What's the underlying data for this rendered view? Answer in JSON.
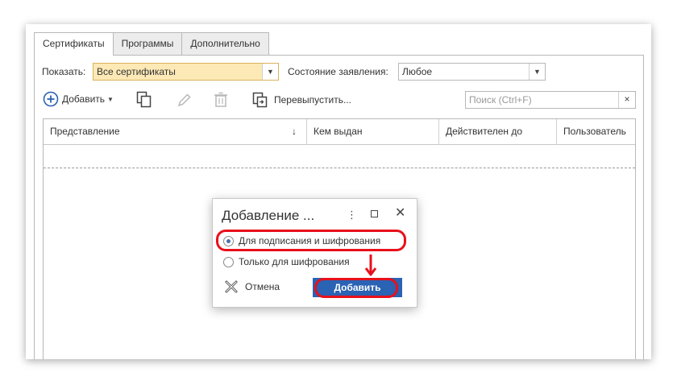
{
  "tabs": [
    {
      "label": "Сертификаты",
      "active": true
    },
    {
      "label": "Программы",
      "active": false
    },
    {
      "label": "Дополнительно",
      "active": false
    }
  ],
  "filters": {
    "show_label": "Показать:",
    "show_value": "Все сертификаты",
    "state_label": "Состояние заявления:",
    "state_value": "Любое"
  },
  "toolbar": {
    "add_label": "Добавить",
    "reissue_label": "Перевыпустить...",
    "search_placeholder": "Поиск (Ctrl+F)",
    "search_clear": "×"
  },
  "table": {
    "columns": [
      "Представление",
      "Кем выдан",
      "Действителен до",
      "Пользователь"
    ],
    "sort_indicator": "↓"
  },
  "dialog": {
    "title": "Добавление ...",
    "option_sign_encrypt": "Для подписания и шифрования",
    "option_encrypt_only": "Только для шифрования",
    "selected_option": "option_sign_encrypt",
    "cancel_label": "Отмена",
    "add_label": "Добавить"
  },
  "colors": {
    "accent_blue": "#2a62b4",
    "highlight_red": "#e8101a",
    "combo_highlight": "#fde9b6"
  }
}
